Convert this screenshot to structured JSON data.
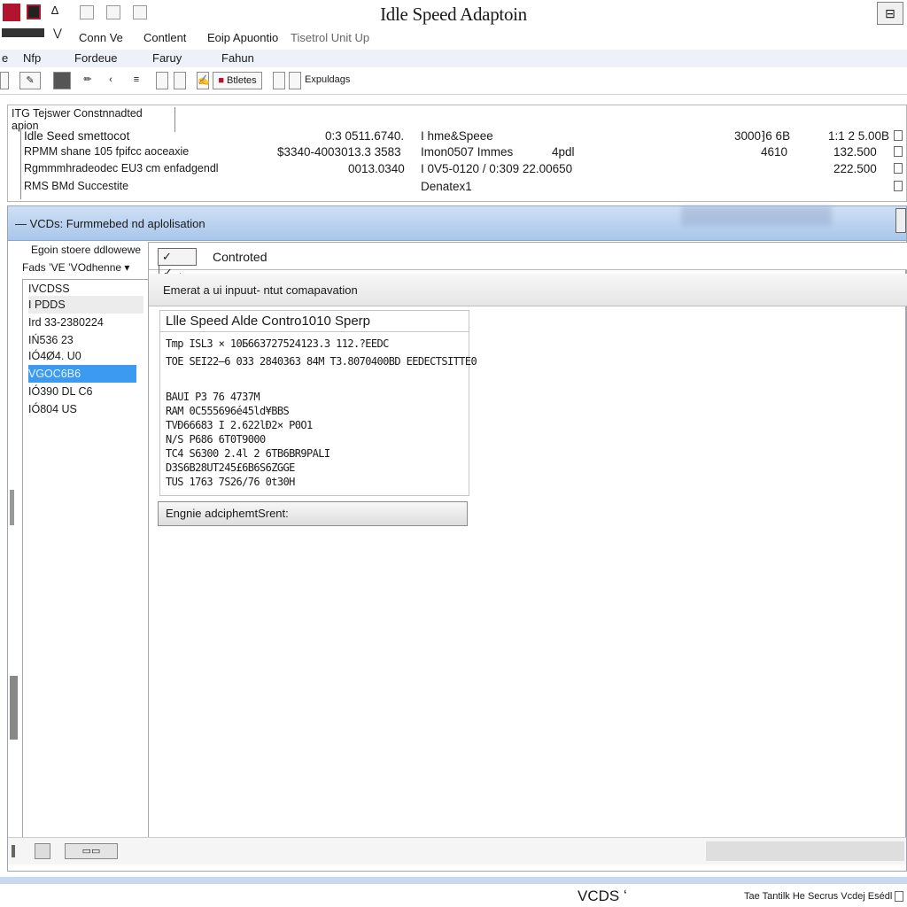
{
  "window": {
    "title": "Idle Speed Adaptoin",
    "close_glyph": "⊟"
  },
  "menubar1": {
    "items": [
      "Conn Ve",
      "Contlent",
      "Eoip Apuontio",
      "Tisetrol Unit Up"
    ]
  },
  "menubar2": {
    "items": [
      "Nfp",
      "Fordeue",
      "Faruy",
      "Fahun"
    ]
  },
  "toolbar": {
    "button_label": "Btletes",
    "settings_label": "Expuldags"
  },
  "info_strip": {
    "header": "ITG Tejswer Constnnadted apion",
    "rows": [
      [
        "Idle Seed smettocot",
        "0:3 0511.6740.",
        "I hme&Speee",
        "3000⁆6 6B",
        "1:1 2 5.00B"
      ],
      [
        "RPMM shane 105 fpifcc aoceaxie",
        "$3340‐4003013.3   3583",
        "Imon0507 Ιmmes",
        "4610",
        "132.500"
      ],
      [
        "Rgmmmhradeodec  EU3 cm enfadgendl",
        "0013.0340",
        "I 0V5-0120 / 0:309 22.00650",
        "",
        "222.500"
      ],
      [
        "RMS BMd Succestite",
        "",
        "Denatex1",
        "",
        ""
      ]
    ],
    "row3_extra": "4pdl"
  },
  "subwindow": {
    "title": "VCDs: Furmmebed nd aplolisation",
    "left": {
      "header1": "Egoin stoere ddlowewe",
      "header2": "Fads   ’VE   ’VOdhenne",
      "items": [
        "IVCDSS",
        "I PDDS",
        "Ird 33-2380224",
        "IŃ536 23",
        "IÓ4Ø4. U0",
        "VGOC6B6",
        "IÓ390 DL C6",
        "IÓ804 US"
      ],
      "selected_index": 5
    },
    "control": {
      "label": "Controted",
      "check_glyph": "✓"
    },
    "prompt": "Emerat a ui inpuut-  ntut comapavation",
    "result": {
      "title": "Llle Speed Alde Contro1010 Sperp",
      "lines": [
        "Tmp ISL3 × 10Б663727524123.3  112.?EEDC",
        "TOE SEI22—6 033 2840363 84M T3.8070400BD EEDECTSITTE0",
        "",
        "BAUI P3 76 4737M",
        "RAM  0C555696é45ld¥BBS",
        "TVÐ66683  I 2.622lÐ2× P0O1",
        "N/S P686 6T0T9000",
        "TC4 S6300 2.4l  2 6TB6BR9PALI",
        "D3S6B28UT245£6B6S6ZGGE",
        "TUS 1763 7S26/76 0t30H"
      ]
    },
    "engine_button": "Engnie adciphemtSrent:",
    "status_btn2": "▭▭"
  },
  "footer": {
    "brand": "VCDS",
    "brand_suffix": "ʻ",
    "right_text": "Tae Tantilk He Secrus Vcdej Esédl"
  },
  "colors": {
    "selection": "#3c9bf0",
    "titlebar_gradient_top": "#cfe0f5",
    "titlebar_gradient_bottom": "#a9c6ea"
  }
}
